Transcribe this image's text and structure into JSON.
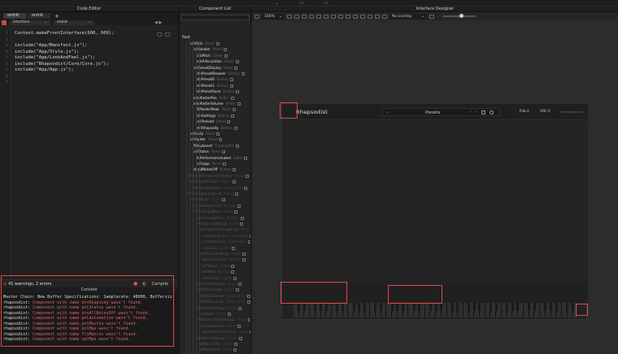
{
  "code_editor": {
    "title": "Code Editor",
    "tabs": [
      "onInit",
      "onInit"
    ],
    "selectors": [
      "Interface",
      "onInit"
    ],
    "lines": [
      "Content.makeFrontInterface(600, 600);",
      "",
      "include(\"App/Manifest.js\");",
      "include(\"App/Style.js\");",
      "include(\"App/LookAndFeel.js\");",
      "include(\"Rhapsodist/Core/Core.js\");",
      "include(\"App/App.js\");",
      "",
      ""
    ],
    "line_numbers": [
      "1",
      "2",
      "3",
      "4",
      "5",
      "6",
      "7",
      "8",
      "9"
    ]
  },
  "console": {
    "status": "41 warnings, 2 errors",
    "compile_label": "Compile",
    "title": "Console",
    "info_line": "Master Chain: New Buffer Specifications: Samplerate: 48000, Buffersiz:",
    "errors": [
      {
        "prefix": "rhapsodist:",
        "msg": "Component with name btnRhapsody wasn't found."
      },
      {
        "prefix": "rhapsodist:",
        "msg": "Component with name pnlStatus wasn't found."
      },
      {
        "prefix": "rhapsodist:",
        "msg": "Component with name btnAllNotesOff wasn't found."
      },
      {
        "prefix": "rhapsodist:",
        "msg": "Component with name pnlAutomation wasn't found."
      },
      {
        "prefix": "rhapsodist:",
        "msg": "Component with name pnlMacros wasn't found."
      },
      {
        "prefix": "rhapsodist:",
        "msg": "Component with name pnlMpe wasn't found."
      },
      {
        "prefix": "rhapsodist:",
        "msg": "Component with name fltMacros wasn't found."
      },
      {
        "prefix": "rhapsodist:",
        "msg": "Component with name vptMpe wasn't found."
      }
    ]
  },
  "component_list": {
    "title": "Component List",
    "root": "Root",
    "items": [
      {
        "label": "pnlMain",
        "type": "Panel"
      },
      {
        "label": "pnlHeader",
        "type": "Panel"
      },
      {
        "label": "knbPitch",
        "type": "Slider"
      },
      {
        "label": "knbArticulation",
        "type": "Slider"
      },
      {
        "label": "pnlPresetDisplay",
        "type": "Panel"
      },
      {
        "label": "btnPresetBrowser",
        "type": "Button"
      },
      {
        "label": "btnPreset0",
        "type": "Button"
      },
      {
        "label": "btnPreset1",
        "type": "Button"
      },
      {
        "label": "btnPresetSave",
        "type": "Button"
      },
      {
        "label": "knbMasterPan",
        "type": "Slider"
      },
      {
        "label": "knbMasterVolume",
        "type": "Slider"
      },
      {
        "label": "fltMasterPeak",
        "type": "Panel"
      },
      {
        "label": "btnSettings",
        "type": "Button"
      },
      {
        "label": "pnlPreload",
        "type": "Panel"
      },
      {
        "label": "btnRhapsody",
        "type": "Button"
      },
      {
        "label": "pnlBody",
        "type": "Panel"
      },
      {
        "label": "pnlFooter",
        "type": "Panel"
      },
      {
        "label": "fltKeyboard",
        "type": "FloatingTile"
      },
      {
        "label": "pnlStatus",
        "type": "Panel"
      },
      {
        "label": "lblPerformanceLabel",
        "type": "Label"
      },
      {
        "label": "pnlLogo",
        "type": "Panel"
      },
      {
        "label": "btnAllNotesOff",
        "type": "Button"
      },
      {
        "label": "pnlPresetBrowserContainer",
        "type": "Panel"
      },
      {
        "label": "pnlPresetBrowser",
        "type": "Panel"
      },
      {
        "label": "fltPresetBrowser",
        "type": "FloatingTile"
      },
      {
        "label": "pnlSettingsContainer",
        "type": "Panel"
      },
      {
        "label": "pnlSettings",
        "type": "Panel"
      },
      {
        "label": "btnSettingsClose",
        "type": "Button"
      },
      {
        "label": "pnlSettingsMenu",
        "type": "Panel"
      },
      {
        "label": "btnSettingsMenu",
        "type": "Button"
      },
      {
        "label": "pnlEngineSettings",
        "type": "Panel"
      },
      {
        "label": "pnlEngineSettingsInner",
        "type": "Panel"
      },
      {
        "label": "cmbVoiceLimit",
        "type": "ComboBox"
      },
      {
        "label": "cmbMpeZone",
        "type": "ComboBox"
      },
      {
        "label": "knbGlide",
        "type": "Slider"
      },
      {
        "label": "pnlGlobalSettings",
        "type": "Panel"
      },
      {
        "label": "btnGlobalAuto",
        "type": "Button"
      },
      {
        "label": "lblTempo",
        "type": "Label"
      },
      {
        "label": "btnMpe",
        "type": "Button"
      },
      {
        "label": "lblVelocity",
        "type": "Label"
      },
      {
        "label": "pnlAudioSettings",
        "type": "Panel"
      },
      {
        "label": "pnlMidiSettings",
        "type": "Panel"
      },
      {
        "label": "fltMidiChannel",
        "type": "FloatingTile"
      },
      {
        "label": "fltMidiSources",
        "type": "FloatingTile"
      },
      {
        "label": "pnlAboutSettings",
        "type": "Panel"
      },
      {
        "label": "pnlAbout",
        "type": "Panel"
      },
      {
        "label": "pnlAutomationSettings",
        "type": "Panel"
      },
      {
        "label": "pnlAutomation",
        "type": "Panel"
      },
      {
        "label": "pnlAutomationInner",
        "type": "Panel"
      },
      {
        "label": "pnlMacroSettings",
        "type": "Panel"
      },
      {
        "label": "lblMacroTitle",
        "type": "Label"
      },
      {
        "label": "lblMacroSub",
        "type": "Label"
      },
      {
        "label": "btnCompare",
        "type": "Button"
      }
    ]
  },
  "designer": {
    "title": "Interface Designer",
    "zoom": "100%",
    "overlay": "No overlay"
  },
  "plugin": {
    "title": "Rhapsodist",
    "preset_label": "Presets",
    "date_label": "Feb 2",
    "vol_label": "VOL 0"
  }
}
